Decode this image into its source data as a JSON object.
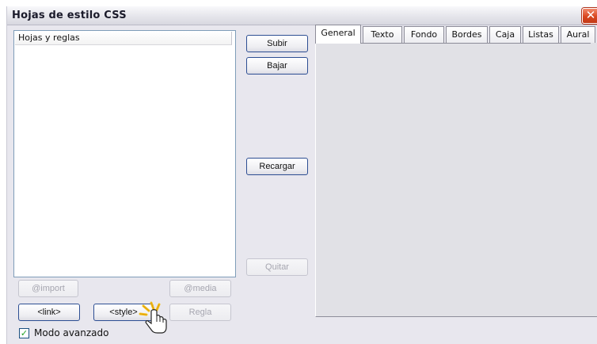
{
  "window": {
    "title": "Hojas de estilo CSS",
    "close_icon": "close-x-icon"
  },
  "panel": {
    "header": "Hojas y reglas"
  },
  "buttons": {
    "import": "@import",
    "media": "@media",
    "link": "<link>",
    "style": "<style>",
    "rule": "Regla",
    "up": "Subir",
    "down": "Bajar",
    "reload": "Recargar",
    "remove": "Quitar"
  },
  "tabs": [
    "General",
    "Texto",
    "Fondo",
    "Bordes",
    "Caja",
    "Listas",
    "Aural"
  ],
  "advanced_mode": {
    "label": "Modo avanzado",
    "checked": true
  },
  "colors": {
    "window_bg": "#e8e7ee",
    "close_button": "#d9461f",
    "button_border": "#2d4e93",
    "checkbox_tick": "#22a022"
  }
}
